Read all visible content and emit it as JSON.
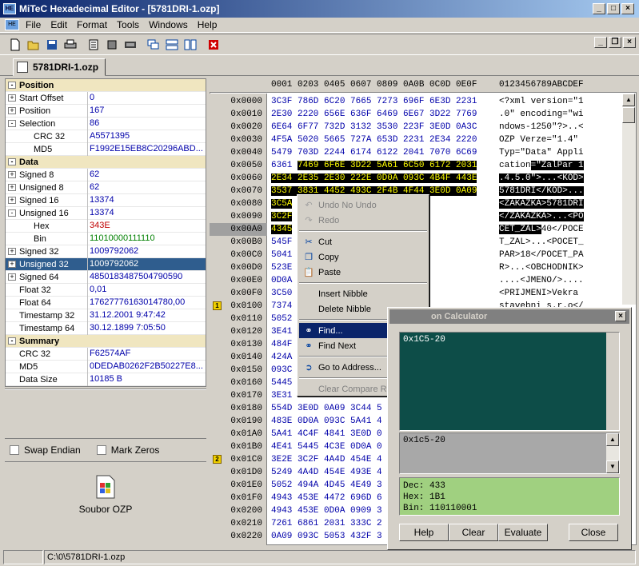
{
  "app": {
    "title": "MiTeC Hexadecimal Editor - [5781DRI-1.ozp]",
    "icon": "hex-app-icon"
  },
  "menu": [
    "File",
    "Edit",
    "Format",
    "Tools",
    "Windows",
    "Help"
  ],
  "toolbar_icons": [
    "new-file-icon",
    "open-folder-icon",
    "save-icon",
    "print-icon",
    "properties-icon",
    "cut-icon",
    "keyboard-icon",
    "windows-cascade-icon",
    "tile-horizontal-icon",
    "tile-vertical-icon",
    "close-red-icon"
  ],
  "tab": {
    "label": "5781DRI-1.ozp"
  },
  "props": [
    {
      "type": "cat",
      "label": "Position",
      "exp": "-"
    },
    {
      "label": "Start Offset",
      "value": "0",
      "exp": "+"
    },
    {
      "label": "Position",
      "value": "167",
      "exp": "+"
    },
    {
      "label": "Selection",
      "value": "86",
      "exp": "-"
    },
    {
      "label": "CRC 32",
      "value": "A5571395",
      "sub": true
    },
    {
      "label": "MD5",
      "value": "F1992E15EB8C20296ABD...",
      "sub": true
    },
    {
      "type": "cat",
      "label": "Data",
      "exp": "-"
    },
    {
      "label": "Signed 8",
      "value": "62",
      "exp": "+"
    },
    {
      "label": "Unsigned 8",
      "value": "62",
      "exp": "+"
    },
    {
      "label": "Signed 16",
      "value": "13374",
      "exp": "+"
    },
    {
      "label": "Unsigned 16",
      "value": "13374",
      "exp": "-"
    },
    {
      "label": "Hex",
      "value": "343E",
      "sub": true,
      "color": "#c00000"
    },
    {
      "label": "Bin",
      "value": "11010000111110",
      "sub": true,
      "color": "#008000"
    },
    {
      "label": "Signed 32",
      "value": "1009792062",
      "exp": "+"
    },
    {
      "label": "Unsigned 32",
      "value": "1009792062",
      "exp": "+",
      "sel": true
    },
    {
      "label": "Signed 64",
      "value": "4850183487504790590",
      "exp": "+"
    },
    {
      "label": "Float 32",
      "value": "0,01"
    },
    {
      "label": "Float 64",
      "value": "17627776163014780,00"
    },
    {
      "label": "Timestamp 32",
      "value": "31.12.2001 9:47:42"
    },
    {
      "label": "Timestamp 64",
      "value": "30.12.1899 7:05:50"
    },
    {
      "type": "cat",
      "label": "Summary",
      "exp": "-"
    },
    {
      "label": "CRC 32",
      "value": "F62574AF"
    },
    {
      "label": "MD5",
      "value": "0DEDAB0262F2B50227E8..."
    },
    {
      "label": "Data Size",
      "value": "10185 B"
    }
  ],
  "options": {
    "swap_endian": "Swap Endian",
    "mark_zeros": "Mark Zeros"
  },
  "file_icon": {
    "label": "Soubor OZP",
    "icon": "windows-file-icon"
  },
  "hex": {
    "header_hex": "0001 0203 0405 0607 0809 0A0B 0C0D 0E0F",
    "header_ascii": "0123456789ABCDEF",
    "rows": [
      {
        "off": "0x0000",
        "hex": "3C3F 786D 6C20 7665 7273 696F 6E3D 2231",
        "asc": "<?xml version=\"1"
      },
      {
        "off": "0x0010",
        "hex": "2E30 2220 656E 636F 6469 6E67 3D22 7769",
        "asc": ".0\" encoding=\"wi"
      },
      {
        "off": "0x0020",
        "hex": "6E64 6F77 732D 3132 3530 223F 3E0D 0A3C",
        "asc": "ndows-1250\"?>..<"
      },
      {
        "off": "0x0030",
        "hex": "4F5A 5020 5665 727A 653D 2231 2E34 2220",
        "asc": "OZP Verze=\"1.4\" "
      },
      {
        "off": "0x0040",
        "hex": "5479 703D 2244 6174 6122 2041 7070 6C69",
        "asc": "Typ=\"Data\" Appli"
      },
      {
        "off": "0x0050",
        "hex": "6361 7469 6F6E 3D22 5A61 6C50 6172 2031",
        "asc": "cation=\"ZalPar 1"
      },
      {
        "off": "0x0060",
        "hex": "2E34 2E35 2E30 222E 0D0A 093C 4B4F 443E",
        "asc": ".4.5.0\">...<KOD>"
      },
      {
        "off": "0x0070",
        "hex": "3537 3831 4452 493C 2F4B 4F44 3E0D 0A09",
        "asc": "5781DRI</KOD>..."
      },
      {
        "off": "0x0080",
        "hex": "3C5A",
        "asc": "<ZAKAZKA>5781DRI"
      },
      {
        "off": "0x0090",
        "hex": "3C2F",
        "asc": "</ZAKAZKA>...<PO"
      },
      {
        "off": "0x00A0",
        "hex": "4345",
        "asc": "CET_ZAL>40</POCE"
      },
      {
        "off": "0x00B0",
        "hex": "545F",
        "asc": "T_ZAL>...<POCET_"
      },
      {
        "off": "0x00C0",
        "hex": "5041",
        "asc": "PAR>18</POCET_PA"
      },
      {
        "off": "0x00D0",
        "hex": "523E",
        "asc": "R>...<OBCHODNIK>"
      },
      {
        "off": "0x00E0",
        "hex": "0D0A",
        "asc": "....<JMENO/>...."
      },
      {
        "off": "0x00F0",
        "hex": "3C50",
        "asc": "<PRIJMENI>Vekra"
      },
      {
        "off": "0x0100",
        "hex": "7374",
        "asc": "stavebni s.r.o</"
      },
      {
        "off": "0x0110",
        "hex": "5052"
      },
      {
        "off": "0x0120",
        "hex": "3E41"
      },
      {
        "off": "0x0130",
        "hex": "484F"
      },
      {
        "off": "0x0140",
        "hex": "424A"
      },
      {
        "off": "0x0150",
        "hex": "093C"
      },
      {
        "off": "0x0160",
        "hex": "5445"
      },
      {
        "off": "0x0170",
        "hex": "3E31"
      },
      {
        "off": "0x0180",
        "hex": "554D 3E0D 0A09 3C44 5"
      },
      {
        "off": "0x0190",
        "hex": "483E 0D0A 093C 5A41 4"
      },
      {
        "off": "0x01A0",
        "hex": "5A41 4C4F 4841 3E0D 0"
      },
      {
        "off": "0x01B0",
        "hex": "4E41 5445 4C3E 0D0A 0"
      },
      {
        "off": "0x01C0",
        "hex": "3E2E 3C2F 4A4D 454E 4"
      },
      {
        "off": "0x01D0",
        "hex": "5249 4A4D 454E 493E 4"
      },
      {
        "off": "0x01E0",
        "hex": "5052 494A 4D45 4E49 3"
      },
      {
        "off": "0x01F0",
        "hex": "4943 453E 4472 696D 6"
      },
      {
        "off": "0x0200",
        "hex": "4943 453E 0D0A 0909 3"
      },
      {
        "off": "0x0210",
        "hex": "7261 6861 2031 333C 2"
      },
      {
        "off": "0x0220",
        "hex": "0A09 093C 5053 432F 3"
      }
    ],
    "bookmarks": [
      {
        "row": 16,
        "label": "1"
      },
      {
        "row": 28,
        "label": "2"
      }
    ]
  },
  "context_menu": [
    {
      "label": "Undo No Undo",
      "icon": "undo-icon",
      "disabled": true
    },
    {
      "label": "Redo",
      "icon": "redo-icon",
      "disabled": true
    },
    {
      "sep": true
    },
    {
      "label": "Cut",
      "icon": "scissors-icon"
    },
    {
      "label": "Copy",
      "icon": "copy-icon"
    },
    {
      "label": "Paste",
      "icon": "paste-icon"
    },
    {
      "sep": true
    },
    {
      "label": "Insert Nibble"
    },
    {
      "label": "Delete Nibble"
    },
    {
      "sep": true
    },
    {
      "label": "Find...",
      "icon": "binoculars-icon",
      "highlighted": true
    },
    {
      "label": "Find Next",
      "icon": "binoculars-next-icon"
    },
    {
      "sep": true
    },
    {
      "label": "Go to Address...",
      "icon": "goto-address-icon"
    },
    {
      "sep": true
    },
    {
      "label": "Clear Compare Results",
      "disabled": true
    }
  ],
  "calculator": {
    "title": "on Calculator",
    "expression": "0x1C5-20",
    "input": "0x1c5-20",
    "results": [
      "Dec: 433",
      "Hex: 1B1",
      "Bin: 110110001"
    ],
    "buttons": [
      "Help",
      "Clear",
      "Evaluate",
      "Close"
    ]
  },
  "status": {
    "path": "C:\\0\\5781DRI-1.ozp"
  }
}
